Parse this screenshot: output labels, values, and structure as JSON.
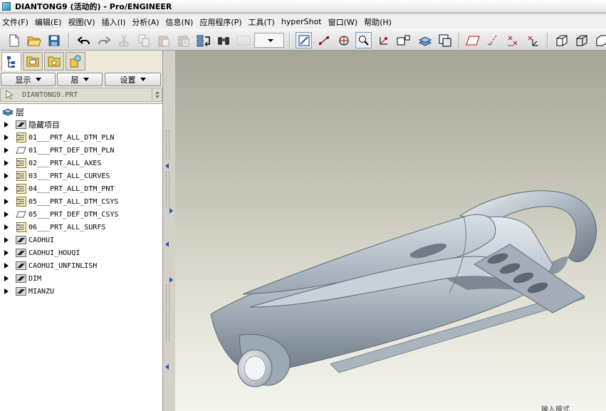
{
  "window": {
    "title": "DIANTONG9 (活动的) - Pro/ENGINEER"
  },
  "menu": [
    {
      "label": "文件(F)"
    },
    {
      "label": "编辑(E)"
    },
    {
      "label": "视图(V)"
    },
    {
      "label": "插入(I)"
    },
    {
      "label": "分析(A)"
    },
    {
      "label": "信息(N)"
    },
    {
      "label": "应用程序(P)"
    },
    {
      "label": "工具(T)"
    },
    {
      "label": "hyperShot"
    },
    {
      "label": "窗口(W)"
    },
    {
      "label": "帮助(H)"
    }
  ],
  "panel": {
    "show_button": "显示",
    "layer_button": "层",
    "settings_button": "设置",
    "model_name": "DIANTONG9.PRT"
  },
  "tree": {
    "root": "层",
    "items": [
      {
        "label": "隐藏项目",
        "icon": "hidden-layer"
      },
      {
        "label": "01___PRT_ALL_DTM_PLN",
        "icon": "layer-rule"
      },
      {
        "label": "01___PRT_DEF_DTM_PLN",
        "icon": "layer-plane"
      },
      {
        "label": "02___PRT_ALL_AXES",
        "icon": "layer-rule"
      },
      {
        "label": "03___PRT_ALL_CURVES",
        "icon": "layer-rule"
      },
      {
        "label": "04___PRT_ALL_DTM_PNT",
        "icon": "layer-rule"
      },
      {
        "label": "05___PRT_ALL_DTM_CSYS",
        "icon": "layer-rule"
      },
      {
        "label": "05___PRT_DEF_DTM_CSYS",
        "icon": "layer-plane"
      },
      {
        "label": "06___PRT_ALL_SURFS",
        "icon": "layer-rule"
      },
      {
        "label": "CAOHUI",
        "icon": "hidden-layer"
      },
      {
        "label": "CAOHUI_HOUQI",
        "icon": "hidden-layer"
      },
      {
        "label": "CAOHUI_UNFINLISH",
        "icon": "hidden-layer"
      },
      {
        "label": "DIM",
        "icon": "hidden-layer"
      },
      {
        "label": "MIANZU",
        "icon": "hidden-layer"
      }
    ]
  },
  "viewport": {
    "status_text": "输入模式"
  },
  "colors": {
    "accent": "#2b4fbf",
    "model_surface": "#b7c2ca"
  }
}
